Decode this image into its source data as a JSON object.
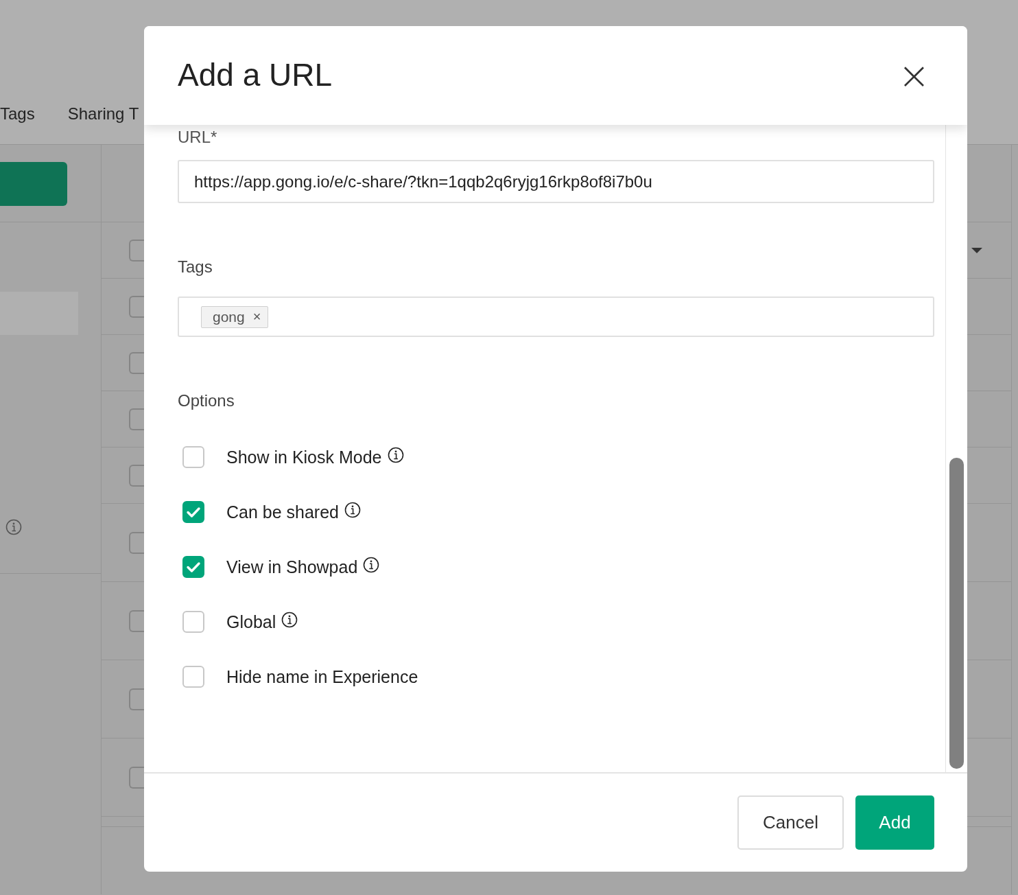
{
  "background": {
    "tabs": [
      "Tags",
      "Sharing T"
    ],
    "rows": [
      {
        "checked": false
      },
      {
        "checked": false
      },
      {
        "checked": false
      },
      {
        "checked": false
      },
      {
        "checked": false
      },
      {
        "checked": false
      },
      {
        "checked": false
      },
      {
        "checked": false
      },
      {
        "checked": false
      }
    ]
  },
  "dialog": {
    "title": "Add a URL",
    "close": "×",
    "url": {
      "label": "URL*",
      "value": "https://app.gong.io/e/c-share/?tkn=1qqb2q6ryjg16rkp8of8i7b0u"
    },
    "tags": {
      "label": "Tags",
      "items": [
        {
          "label": "gong",
          "remove": "×"
        }
      ]
    },
    "options": {
      "label": "Options",
      "items": [
        {
          "label": "Show in Kiosk Mode",
          "checked": false,
          "info": true
        },
        {
          "label": "Can be shared",
          "checked": true,
          "info": true
        },
        {
          "label": "View in Showpad",
          "checked": true,
          "info": true
        },
        {
          "label": "Global",
          "checked": false,
          "info": true
        },
        {
          "label": "Hide name in Experience",
          "checked": false,
          "info": false
        }
      ]
    },
    "buttons": [
      {
        "label": "Cancel",
        "kind": "secondary"
      },
      {
        "label": "Add",
        "kind": "primary"
      }
    ]
  }
}
